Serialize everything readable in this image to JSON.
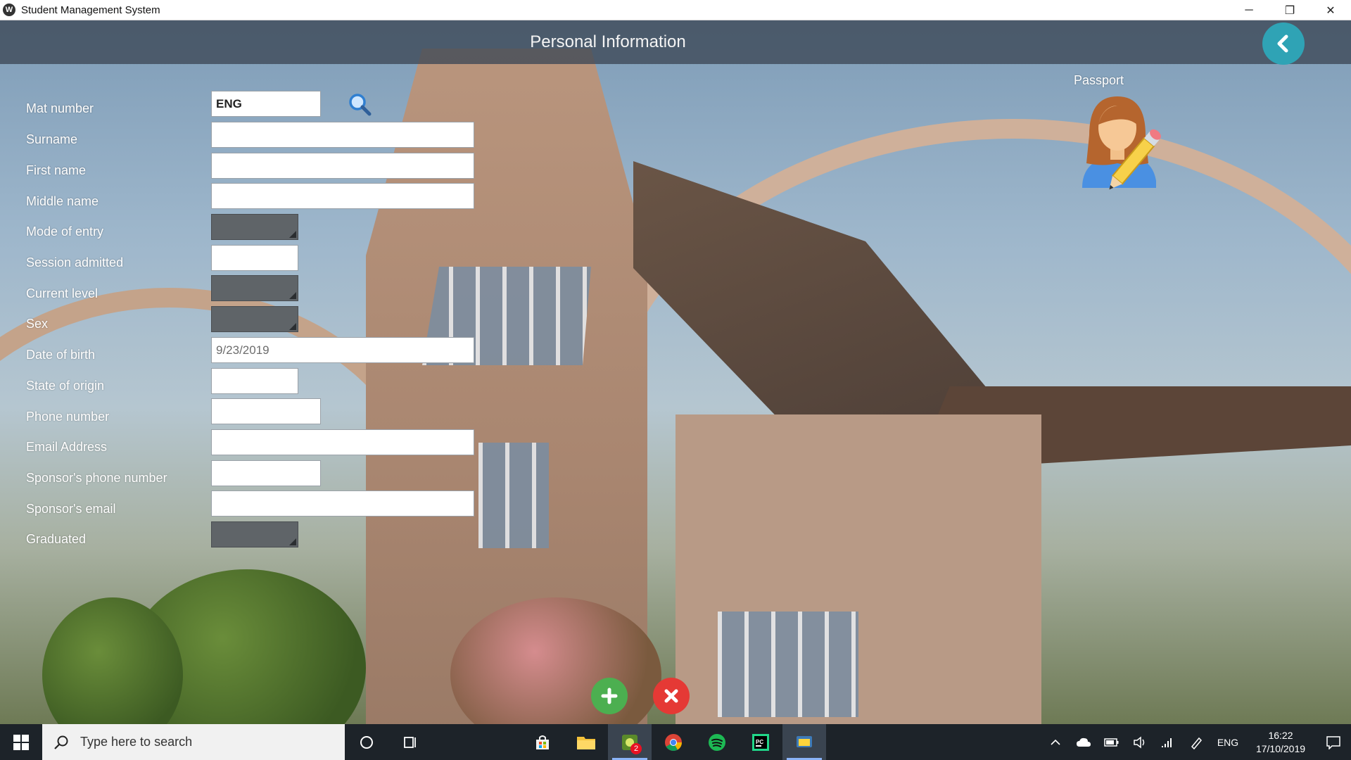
{
  "window": {
    "title": "Student Management System",
    "app_icon_glyph": "W",
    "controls": {
      "minimize": "─",
      "restore": "❐",
      "close": "✕"
    }
  },
  "header": {
    "title": "Personal Information",
    "back_icon": "chevron-left-icon",
    "back_color": "#2fa3b5"
  },
  "form": {
    "fields": [
      {
        "label": "Mat number",
        "value": "ENG",
        "kind": "text"
      },
      {
        "label": "Surname",
        "value": "",
        "kind": "text"
      },
      {
        "label": "First name",
        "value": "",
        "kind": "text"
      },
      {
        "label": "Middle name",
        "value": "",
        "kind": "text"
      },
      {
        "label": "Mode of entry",
        "value": "",
        "kind": "select"
      },
      {
        "label": "Session admitted",
        "value": "",
        "kind": "text"
      },
      {
        "label": "Current level",
        "value": "",
        "kind": "select"
      },
      {
        "label": "Sex",
        "value": "",
        "kind": "select"
      },
      {
        "label": "Date of birth",
        "value": "9/23/2019",
        "kind": "date"
      },
      {
        "label": "State of origin",
        "value": "",
        "kind": "text"
      },
      {
        "label": "Phone number",
        "value": "",
        "kind": "text"
      },
      {
        "label": "Email Address",
        "value": "",
        "kind": "text"
      },
      {
        "label": "Sponsor's phone number",
        "value": "",
        "kind": "text"
      },
      {
        "label": "Sponsor's email",
        "value": "",
        "kind": "text"
      },
      {
        "label": "Graduated",
        "value": "",
        "kind": "select"
      }
    ],
    "search_icon": "search-icon"
  },
  "passport": {
    "label": "Passport",
    "icon": "avatar-edit-icon"
  },
  "actions": {
    "add_icon": "plus-icon",
    "add_color": "#4caf50",
    "cancel_icon": "close-icon",
    "cancel_color": "#e53935"
  },
  "taskbar": {
    "search_placeholder": "Type here to search",
    "pinned": [
      "cortana-icon",
      "task-view-icon",
      "store-icon",
      "file-explorer-icon",
      "messaging-icon",
      "chrome-icon",
      "spotify-icon",
      "pycharm-icon",
      "python-icon"
    ],
    "messaging_badge": "2",
    "tray": {
      "language": "ENG",
      "time": "16:22",
      "date": "17/10/2019"
    }
  }
}
